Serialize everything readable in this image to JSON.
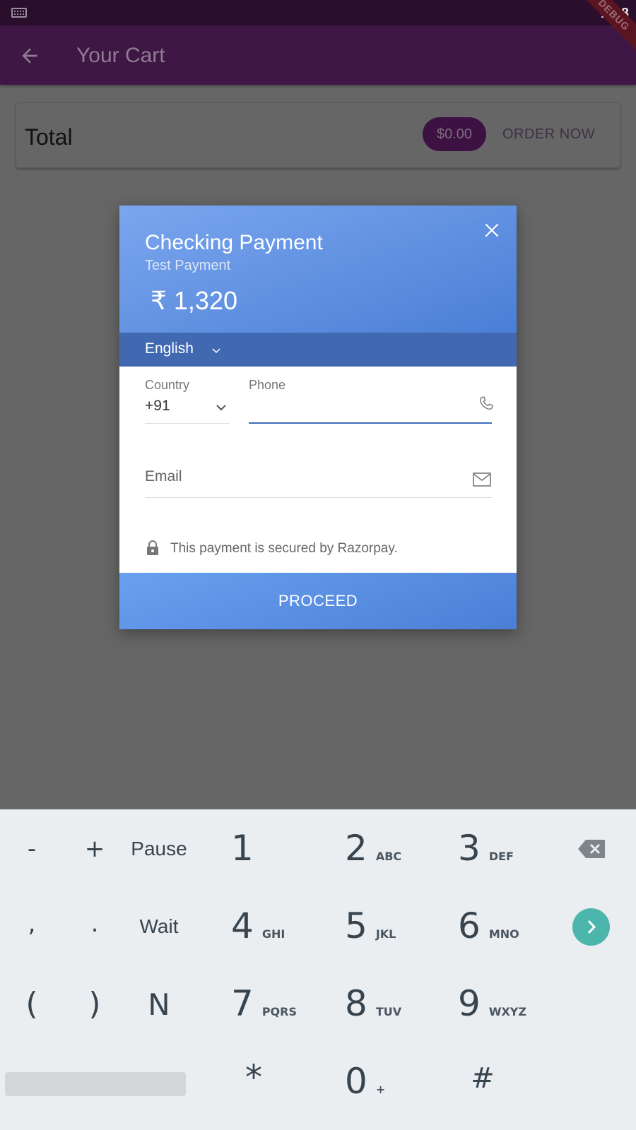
{
  "status_bar": {
    "time": "1:28",
    "icons": [
      "keyboard-icon"
    ]
  },
  "app_bar": {
    "title": "Your Cart",
    "back_icon": "arrow-back-icon",
    "debug_banner": "DEBUG"
  },
  "cart": {
    "total_label": "Total",
    "total_amount": "$0.00",
    "order_button": "ORDER NOW"
  },
  "payment_dialog": {
    "merchant": "Checking Payment",
    "description": "Test Payment",
    "amount": "₹  1,320",
    "language": "English",
    "country_label": "Country",
    "country_code": "+91",
    "phone_label": "Phone",
    "phone_value": "",
    "email_placeholder": "Email",
    "secure_text": "This payment is secured by Razorpay.",
    "proceed_button": "PROCEED"
  },
  "keypad": {
    "row1": {
      "minus": "-",
      "plus": "+",
      "pause": "Pause",
      "k1": "1",
      "k2": "2",
      "k2_sub": "ABC",
      "k3": "3",
      "k3_sub": "DEF"
    },
    "row2": {
      "comma": ",",
      "period": ".",
      "wait": "Wait",
      "k4": "4",
      "k4_sub": "GHI",
      "k5": "5",
      "k5_sub": "JKL",
      "k6": "6",
      "k6_sub": "MNO"
    },
    "row3": {
      "lparen": "(",
      "rparen": ")",
      "n": "N",
      "k7": "7",
      "k7_sub": "PQRS",
      "k8": "8",
      "k8_sub": "TUV",
      "k9": "9",
      "k9_sub": "WXYZ"
    },
    "row4": {
      "star": "*",
      "k0": "0",
      "k0_sub": "+",
      "hash": "#"
    }
  },
  "colors": {
    "app_bar": "#3f1744",
    "status_bar": "#2a0f2c",
    "scrim": "#666666",
    "razorpay_blue": "#4a7fd6",
    "next_key": "#4db6ac"
  }
}
